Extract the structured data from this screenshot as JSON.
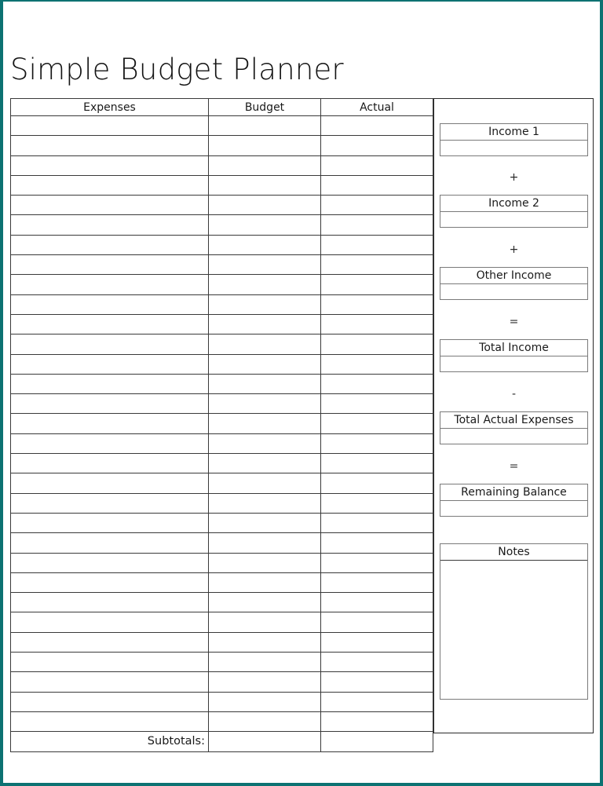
{
  "page": {
    "title": "Simple Budget Planner",
    "border_color": "#0c7272",
    "background": "#ffffff"
  },
  "expense_table": {
    "columns": [
      "Expenses",
      "Budget",
      "Actual"
    ],
    "body_row_count": 31,
    "rows": [
      {
        "expenses": "",
        "budget": "",
        "actual": ""
      },
      {
        "expenses": "",
        "budget": "",
        "actual": ""
      },
      {
        "expenses": "",
        "budget": "",
        "actual": ""
      },
      {
        "expenses": "",
        "budget": "",
        "actual": ""
      },
      {
        "expenses": "",
        "budget": "",
        "actual": ""
      },
      {
        "expenses": "",
        "budget": "",
        "actual": ""
      },
      {
        "expenses": "",
        "budget": "",
        "actual": ""
      },
      {
        "expenses": "",
        "budget": "",
        "actual": ""
      },
      {
        "expenses": "",
        "budget": "",
        "actual": ""
      },
      {
        "expenses": "",
        "budget": "",
        "actual": ""
      },
      {
        "expenses": "",
        "budget": "",
        "actual": ""
      },
      {
        "expenses": "",
        "budget": "",
        "actual": ""
      },
      {
        "expenses": "",
        "budget": "",
        "actual": ""
      },
      {
        "expenses": "",
        "budget": "",
        "actual": ""
      },
      {
        "expenses": "",
        "budget": "",
        "actual": ""
      },
      {
        "expenses": "",
        "budget": "",
        "actual": ""
      },
      {
        "expenses": "",
        "budget": "",
        "actual": ""
      },
      {
        "expenses": "",
        "budget": "",
        "actual": ""
      },
      {
        "expenses": "",
        "budget": "",
        "actual": ""
      },
      {
        "expenses": "",
        "budget": "",
        "actual": ""
      },
      {
        "expenses": "",
        "budget": "",
        "actual": ""
      },
      {
        "expenses": "",
        "budget": "",
        "actual": ""
      },
      {
        "expenses": "",
        "budget": "",
        "actual": ""
      },
      {
        "expenses": "",
        "budget": "",
        "actual": ""
      },
      {
        "expenses": "",
        "budget": "",
        "actual": ""
      },
      {
        "expenses": "",
        "budget": "",
        "actual": ""
      },
      {
        "expenses": "",
        "budget": "",
        "actual": ""
      },
      {
        "expenses": "",
        "budget": "",
        "actual": ""
      },
      {
        "expenses": "",
        "budget": "",
        "actual": ""
      },
      {
        "expenses": "",
        "budget": "",
        "actual": ""
      },
      {
        "expenses": "",
        "budget": "",
        "actual": ""
      }
    ],
    "subtotals": {
      "label": "Subtotals:",
      "budget": "",
      "actual": ""
    }
  },
  "summary": {
    "income_1": {
      "label": "Income 1",
      "value": ""
    },
    "operator_1": "+",
    "income_2": {
      "label": "Income 2",
      "value": ""
    },
    "operator_2": "+",
    "other_income": {
      "label": "Other Income",
      "value": ""
    },
    "operator_3": "=",
    "total_income": {
      "label": "Total Income",
      "value": ""
    },
    "operator_4": "-",
    "total_actual_expenses": {
      "label": "Total Actual Expenses",
      "value": ""
    },
    "operator_5": "=",
    "remaining_balance": {
      "label": "Remaining Balance",
      "value": ""
    },
    "notes": {
      "label": "Notes",
      "value": ""
    }
  }
}
